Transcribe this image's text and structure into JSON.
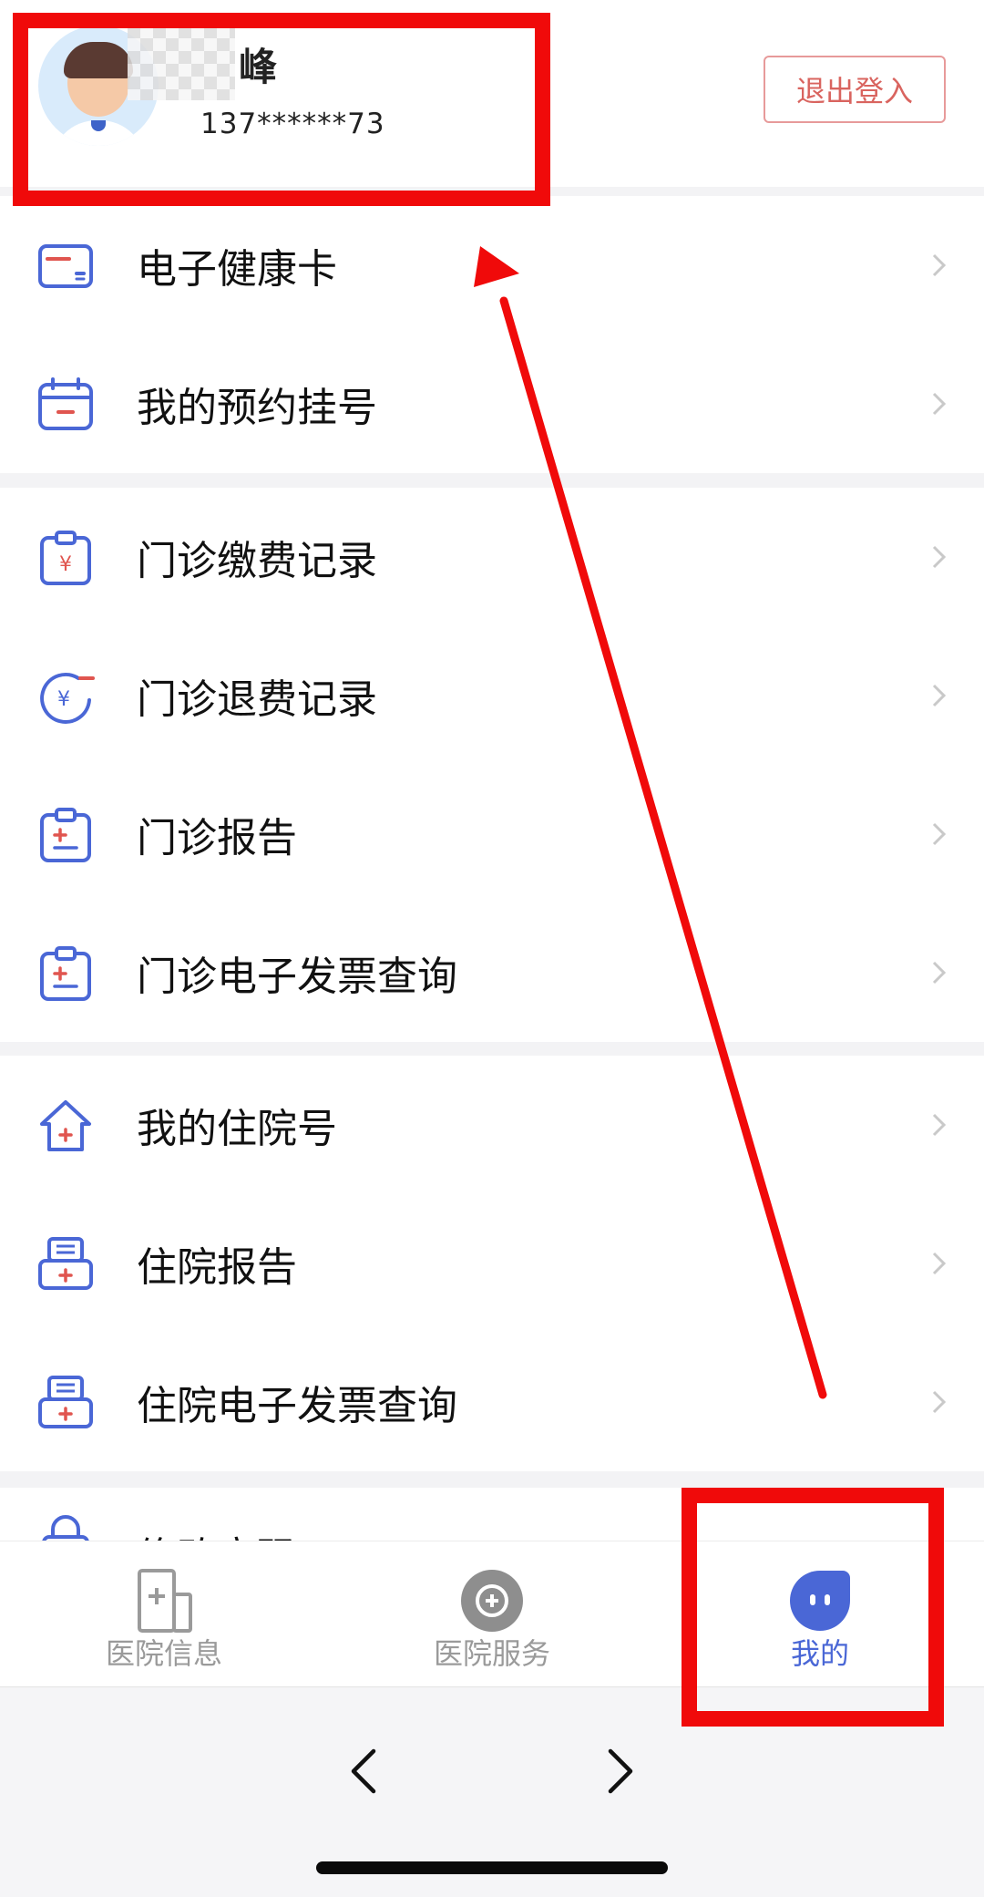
{
  "profile": {
    "name_visible": "峰",
    "phone": "137******73",
    "logout_label": "退出登入"
  },
  "groups": [
    {
      "items": [
        {
          "label": "电子健康卡",
          "icon": "health-card-icon"
        },
        {
          "label": "我的预约挂号",
          "icon": "calendar-icon"
        }
      ]
    },
    {
      "items": [
        {
          "label": "门诊缴费记录",
          "icon": "payment-clipboard-icon"
        },
        {
          "label": "门诊退费记录",
          "icon": "refund-icon"
        },
        {
          "label": "门诊报告",
          "icon": "report-clipboard-icon"
        },
        {
          "label": "门诊电子发票查询",
          "icon": "invoice-clipboard-icon"
        }
      ]
    },
    {
      "items": [
        {
          "label": "我的住院号",
          "icon": "hospital-house-icon"
        },
        {
          "label": "住院报告",
          "icon": "inpatient-report-icon"
        },
        {
          "label": "住院电子发票查询",
          "icon": "inpatient-invoice-icon"
        }
      ]
    }
  ],
  "partial_item": {
    "label": "修改密码"
  },
  "tabs": [
    {
      "label": "医院信息",
      "icon": "hospital-info-icon",
      "active": false
    },
    {
      "label": "医院服务",
      "icon": "hospital-service-icon",
      "active": false
    },
    {
      "label": "我的",
      "icon": "profile-face-icon",
      "active": true
    }
  ],
  "browser": {
    "back": "back-arrow-icon",
    "forward": "forward-arrow-icon"
  },
  "colors": {
    "accent": "#4a67d6",
    "icon_blue": "#4a67d6",
    "icon_red": "#e0554f",
    "annotation_red": "#f00a0a",
    "logout_text": "#d9645f"
  }
}
